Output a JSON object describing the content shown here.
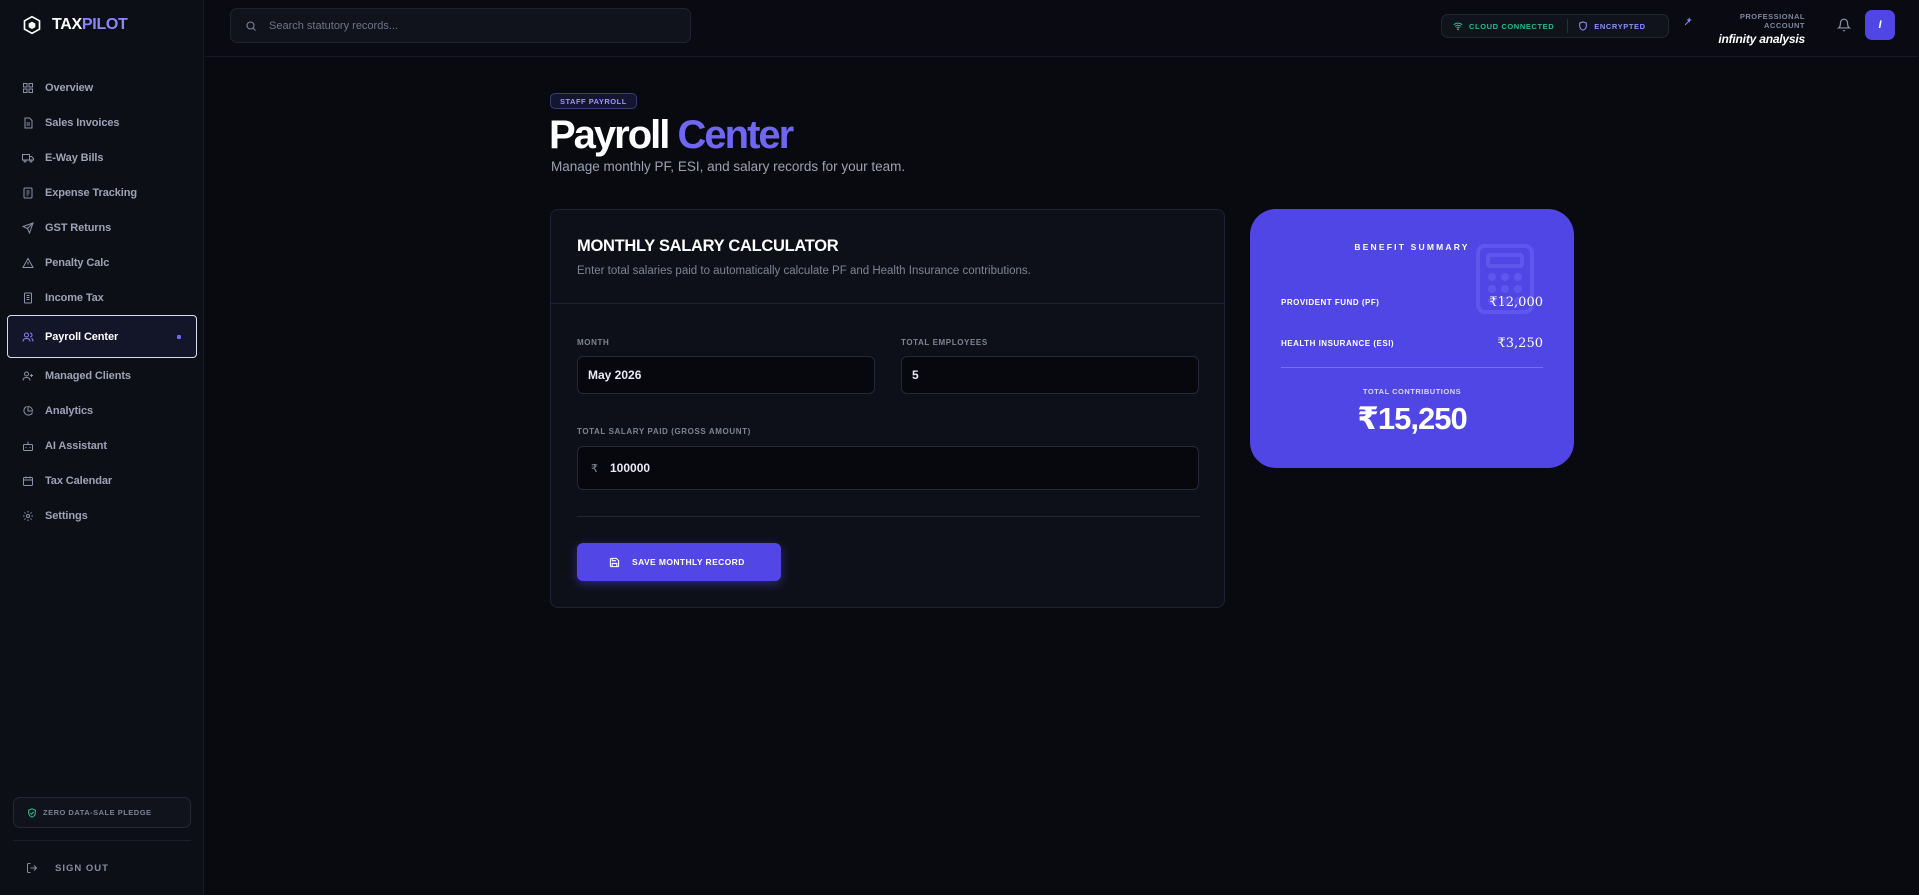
{
  "brand": {
    "name_primary": "TAX",
    "name_accent": "PILOT"
  },
  "search": {
    "placeholder": "Search statutory records..."
  },
  "status": {
    "cloud": "CLOUD CONNECTED",
    "encrypted": "ENCRYPTED"
  },
  "account": {
    "label": "PROFESSIONAL ACCOUNT",
    "name": "infinity analysis",
    "avatar_initial": "I"
  },
  "sidebar": {
    "items": [
      {
        "label": "Overview",
        "icon": "grid-icon"
      },
      {
        "label": "Sales Invoices",
        "icon": "document-icon"
      },
      {
        "label": "E-Way Bills",
        "icon": "truck-icon"
      },
      {
        "label": "Expense Tracking",
        "icon": "receipt-icon"
      },
      {
        "label": "GST Returns",
        "icon": "send-icon"
      },
      {
        "label": "Penalty Calc",
        "icon": "warning-icon"
      },
      {
        "label": "Income Tax",
        "icon": "file-icon"
      },
      {
        "label": "Payroll Center",
        "icon": "users-icon",
        "active": true
      },
      {
        "label": "Managed Clients",
        "icon": "user-plus-icon"
      },
      {
        "label": "Analytics",
        "icon": "pie-chart-icon"
      },
      {
        "label": "AI Assistant",
        "icon": "bot-icon"
      },
      {
        "label": "Tax Calendar",
        "icon": "calendar-icon"
      },
      {
        "label": "Settings",
        "icon": "gear-icon"
      }
    ],
    "pledge": "ZERO DATA-SALE PLEDGE",
    "signout": "SIGN OUT"
  },
  "page": {
    "badge": "STAFF PAYROLL",
    "title_main": "Payroll",
    "title_accent": "Center",
    "subtitle": "Manage monthly PF, ESI, and salary records for your team."
  },
  "calculator": {
    "title": "MONTHLY SALARY CALCULATOR",
    "description": "Enter total salaries paid to automatically calculate PF and Health Insurance contributions.",
    "month_label": "MONTH",
    "month_value": "May 2026",
    "employees_label": "TOTAL EMPLOYEES",
    "employees_value": "5",
    "salary_label": "TOTAL SALARY PAID (GROSS AMOUNT)",
    "currency_symbol": "₹",
    "salary_value": "100000",
    "save_label": "SAVE MONTHLY RECORD"
  },
  "benefits": {
    "title": "BENEFIT SUMMARY",
    "pf_label": "PROVIDENT FUND (PF)",
    "pf_value": "₹12,000",
    "esi_label": "HEALTH INSURANCE (ESI)",
    "esi_value": "₹3,250",
    "total_label": "TOTAL CONTRIBUTIONS",
    "total_value": "₹15,250"
  },
  "colors": {
    "accent": "#4f46e5",
    "background": "#090a10",
    "sidebar": "#0d0f17",
    "success": "#28b98b"
  }
}
